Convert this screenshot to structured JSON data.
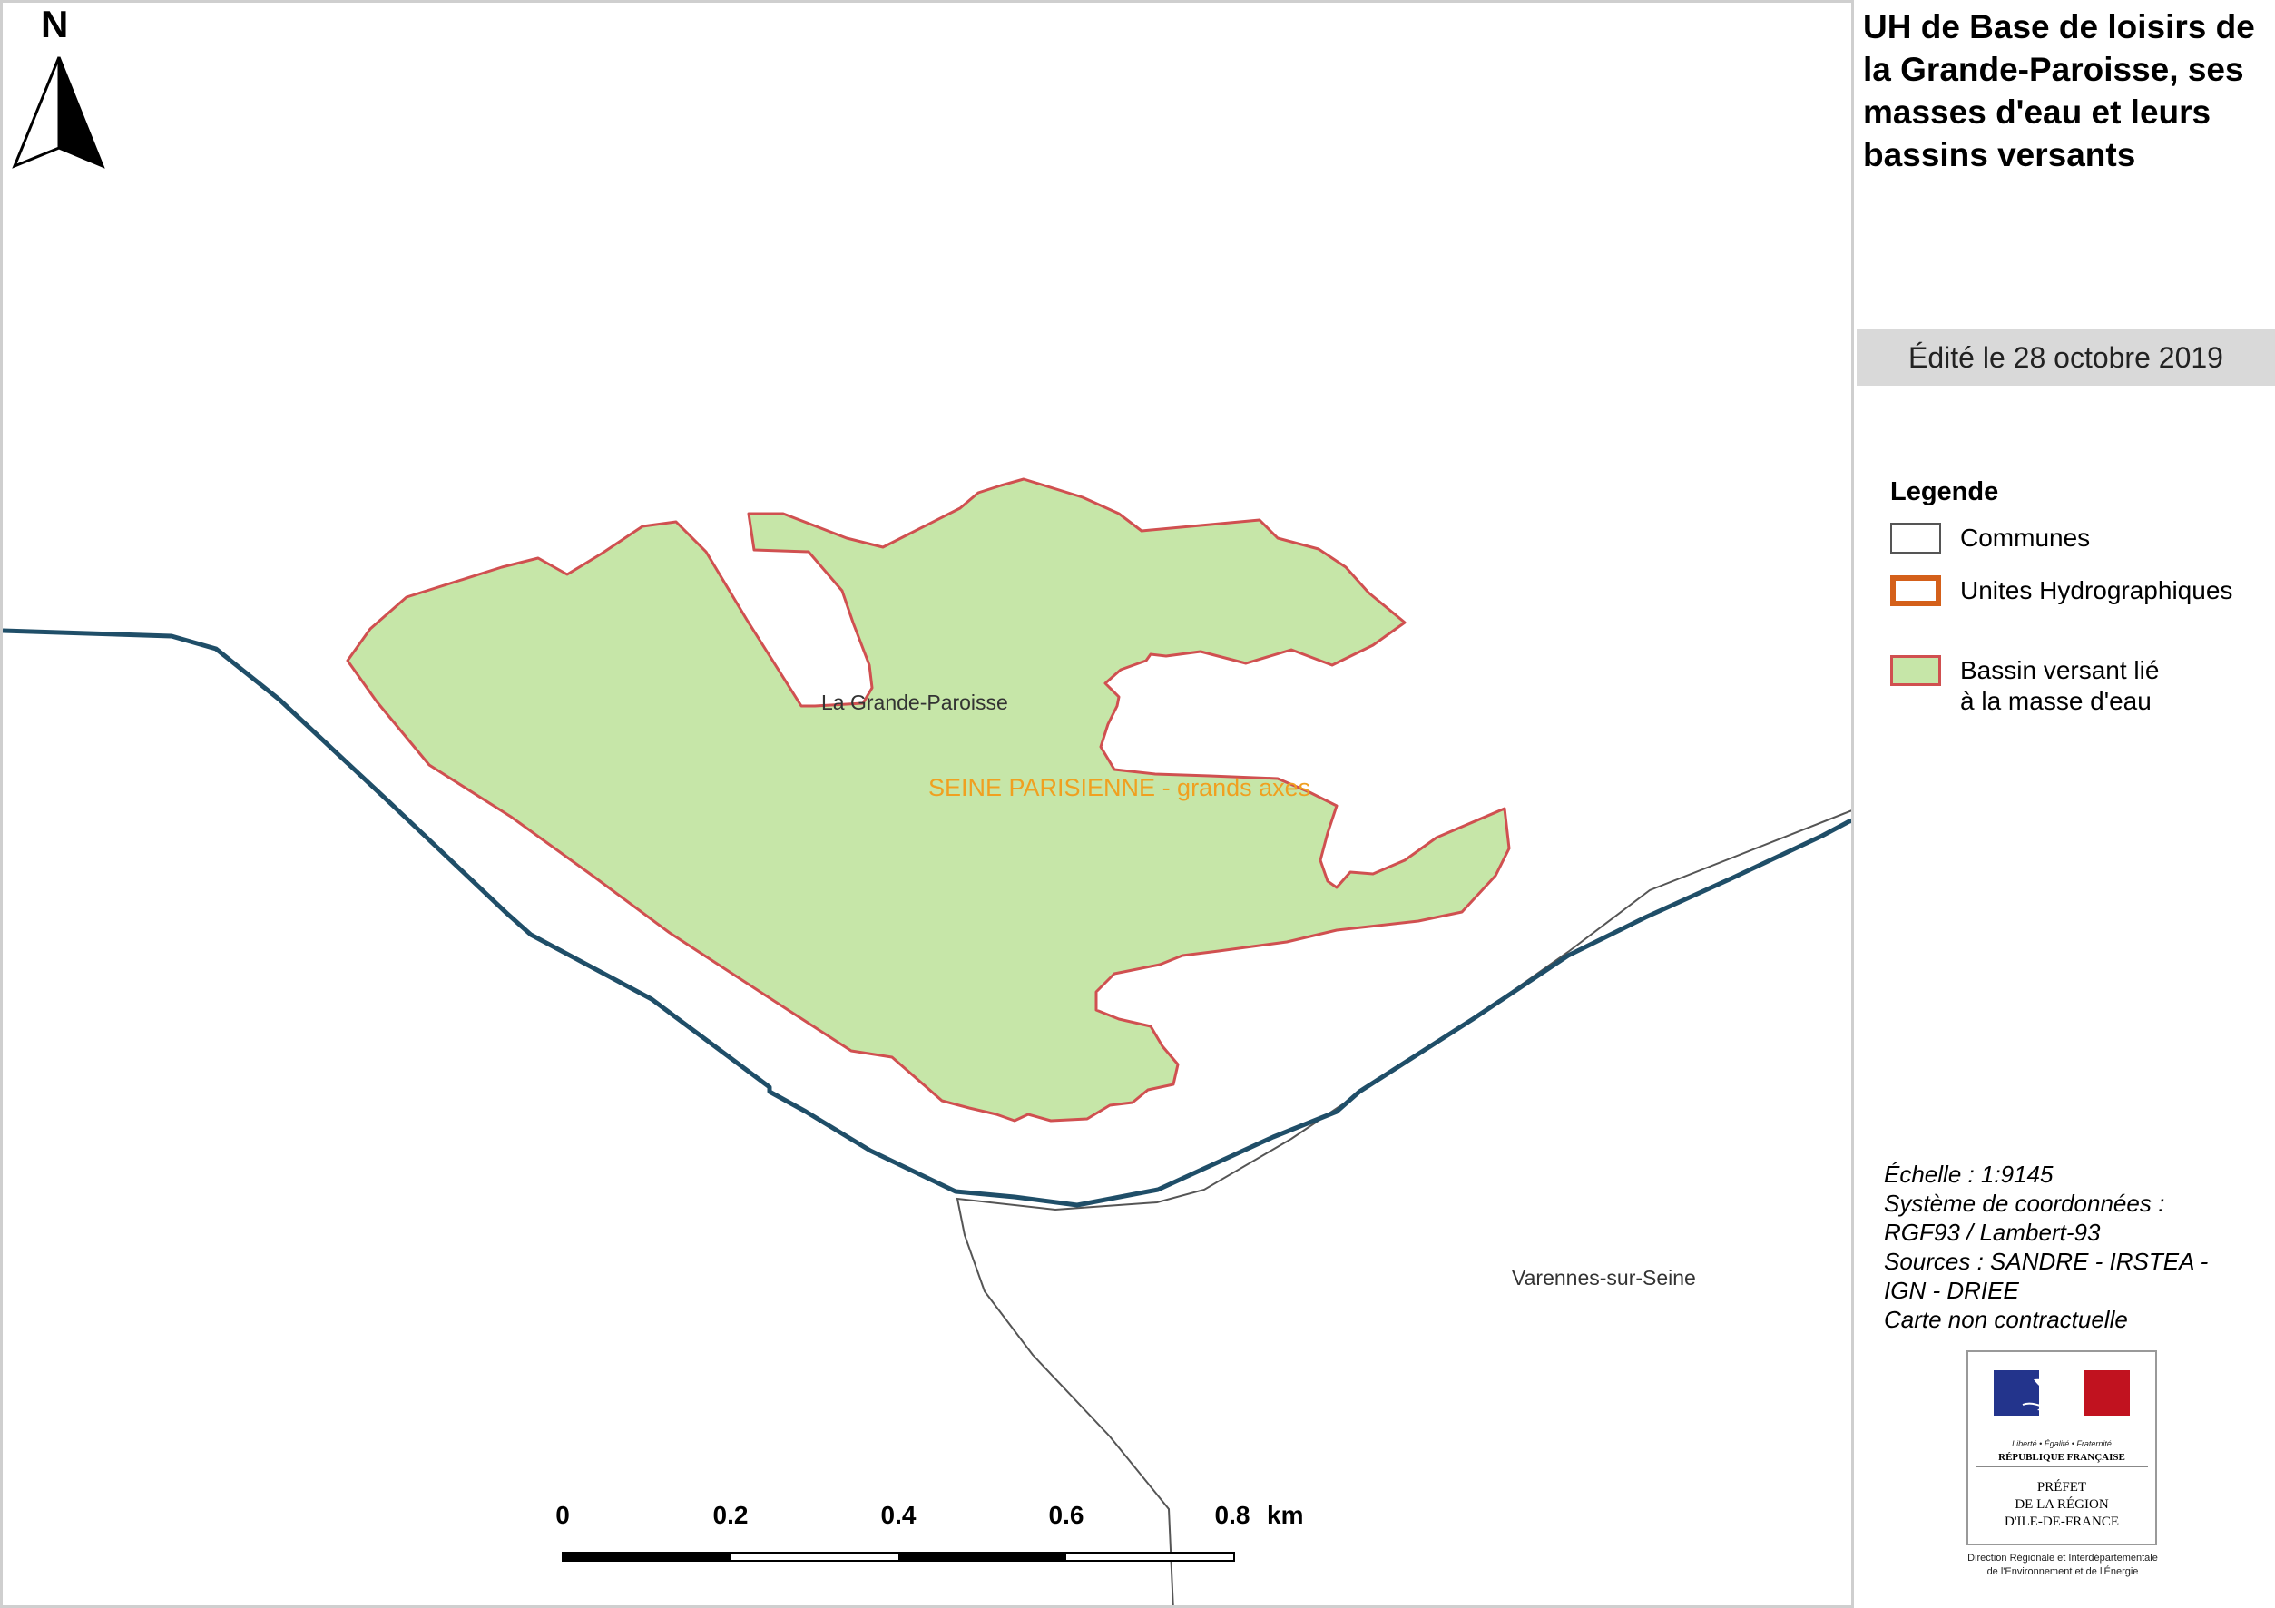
{
  "map": {
    "north_label": "N",
    "labels": {
      "commune_1": "La Grande-Paroisse",
      "water_body": "SEINE PARISIENNE - grands axes",
      "commune_2": "Varennes-sur-Seine"
    },
    "scale_bar": {
      "ticks": [
        "0",
        "0.2",
        "0.4",
        "0.6",
        "0.8"
      ],
      "unit": "km"
    },
    "colors": {
      "river": "#1f4e68",
      "commune_border": "#555555",
      "basin_fill": "#c6e6a8",
      "basin_border": "#d05050",
      "uh_border": "#d4601a"
    }
  },
  "panel": {
    "title": "UH de Base de loisirs de la Grande-Paroisse, ses masses d'eau et leurs bassins versants",
    "date": "Édité le 28 octobre 2019",
    "legend": {
      "title": "Legende",
      "items": [
        {
          "label": "Communes",
          "icon": "commune-swatch"
        },
        {
          "label": "Unites Hydrographiques",
          "icon": "uh-swatch"
        },
        {
          "label_line1": "Bassin versant lié",
          "label_line2": "à la masse d'eau",
          "icon": "basin-swatch"
        }
      ]
    },
    "metadata": {
      "scale": "Échelle :  1:9145",
      "crs_line1": "Système de coordonnées :",
      "crs_line2": "RGF93 / Lambert-93",
      "sources_line1": "Sources : SANDRE - IRSTEA -",
      "sources_line2": "IGN - DRIEE",
      "disclaimer": "Carte non contractuelle"
    },
    "logo": {
      "motto": "Liberté • Égalité • Fraternité",
      "republic": "RÉPUBLIQUE FRANÇAISE",
      "prefet_line1": "PRÉFET",
      "prefet_line2": "DE LA RÉGION",
      "prefet_line3": "D'ILE-DE-FRANCE",
      "direction_line1": "Direction Régionale et Interdépartementale",
      "direction_line2": "de l'Environnement et de l'Énergie"
    }
  }
}
